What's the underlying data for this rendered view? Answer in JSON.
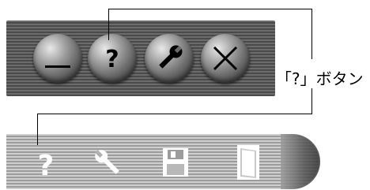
{
  "callout": {
    "label": "「?」ボタン"
  },
  "toolbar_top": {
    "buttons": [
      {
        "icon": "minimize-icon"
      },
      {
        "icon": "help-icon"
      },
      {
        "icon": "wrench-icon"
      },
      {
        "icon": "close-icon"
      }
    ]
  },
  "toolbar_bottom": {
    "buttons": [
      {
        "icon": "help-icon"
      },
      {
        "icon": "wrench-icon"
      },
      {
        "icon": "save-icon"
      },
      {
        "icon": "exit-door-icon"
      }
    ]
  }
}
